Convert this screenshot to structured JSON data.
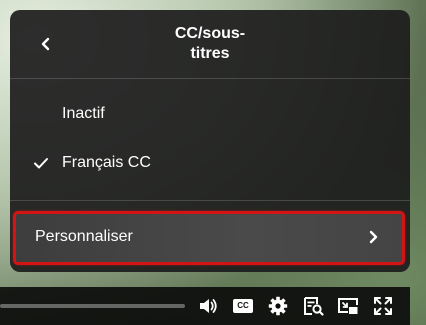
{
  "menu": {
    "title": "CC/sous-\ntitres",
    "back_icon": "chevron-left-icon",
    "options": [
      {
        "label": "Inactif",
        "selected": false
      },
      {
        "label": "Français CC",
        "selected": true
      }
    ],
    "customize": {
      "label": "Personnaliser",
      "icon": "chevron-right-icon",
      "highlight_color": "#d21414"
    }
  },
  "controls": {
    "cc_label": "CC",
    "icons": [
      "volume-icon",
      "cc-icon",
      "settings-gear-icon",
      "transcript-search-icon",
      "picture-in-picture-icon",
      "fullscreen-icon"
    ]
  }
}
